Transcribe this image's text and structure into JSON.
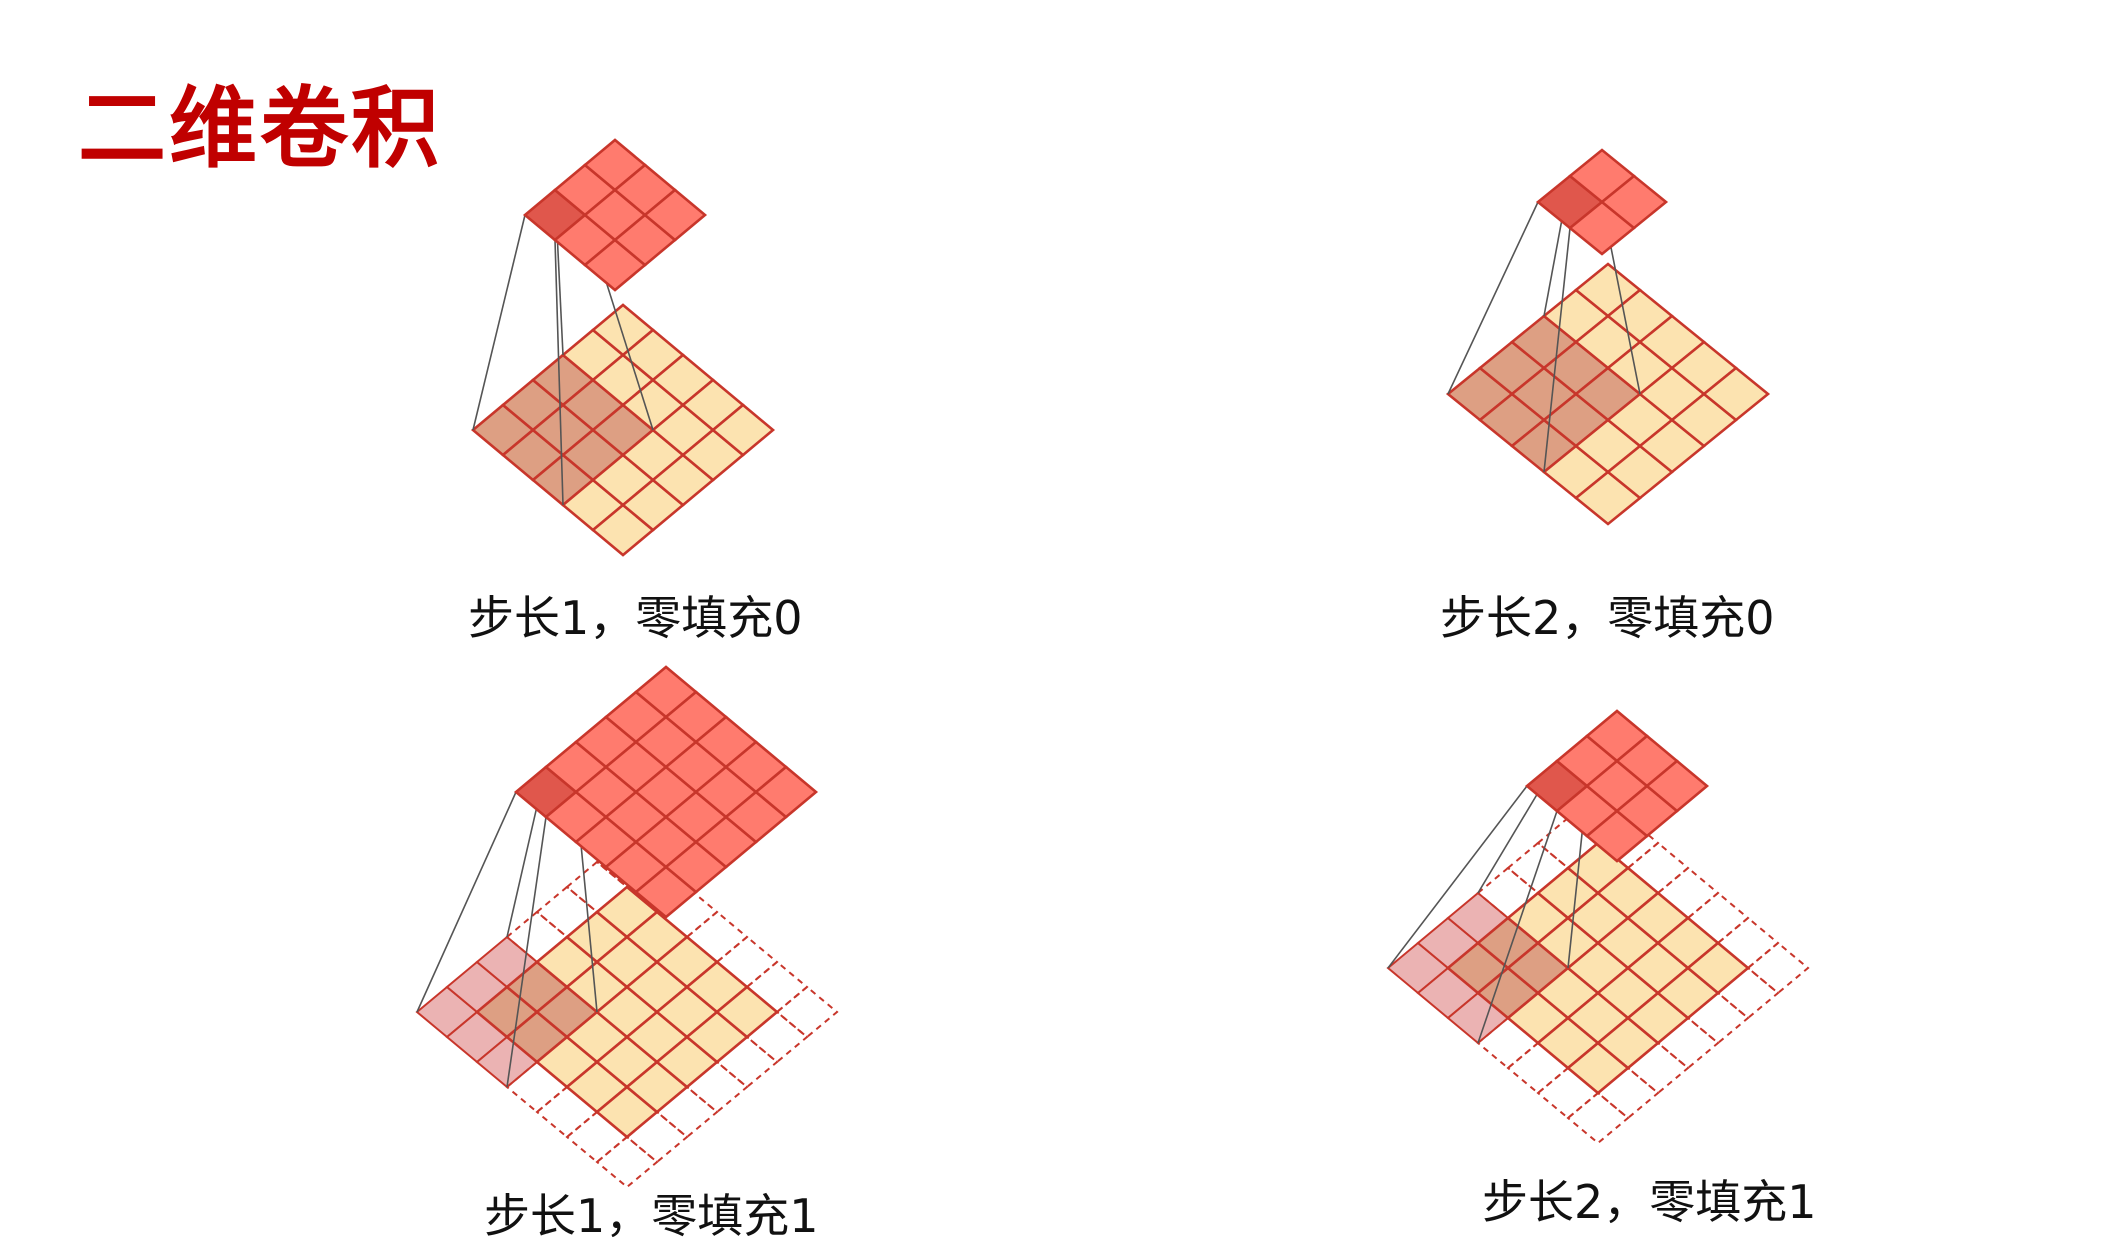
{
  "title": "二维卷积",
  "colors": {
    "title": "#c00000",
    "input_fill": "#fce3b0",
    "input_stroke": "#c8362b",
    "kernel_fill": "#d99575",
    "output_fill": "#ff7b6e",
    "output_active_fill": "#e0574c",
    "padding_fill": "#e8a6a6",
    "connector": "#555555"
  },
  "panels": [
    {
      "caption": "步长1，零填充0",
      "stride": 1,
      "padding": 0,
      "input_size": 5,
      "kernel_size": 3,
      "output_size": 3
    },
    {
      "caption": "步长2，零填充0",
      "stride": 2,
      "padding": 0,
      "input_size": 5,
      "kernel_size": 3,
      "output_size": 2
    },
    {
      "caption": "步长1，零填充1",
      "stride": 1,
      "padding": 1,
      "input_size": 5,
      "kernel_size": 3,
      "output_size": 5
    },
    {
      "caption": "步长2，零填充1",
      "stride": 2,
      "padding": 1,
      "input_size": 5,
      "kernel_size": 3,
      "output_size": 3
    }
  ]
}
